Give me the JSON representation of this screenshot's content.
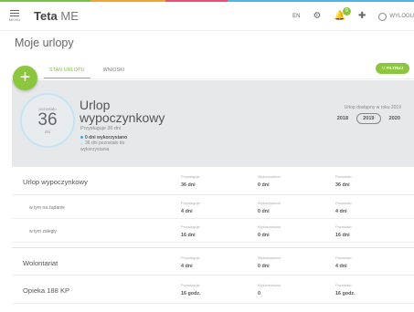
{
  "app": {
    "menu_label": "MENU",
    "brand_bold": "Teta",
    "brand_light": "ME",
    "lang": "EN",
    "notif_count": "9",
    "logout_label": "WYLOGU",
    "icons": [
      "menu-icon",
      "gear-icon",
      "bell-icon",
      "plugin-icon",
      "power-icon"
    ]
  },
  "page": {
    "title": "Moje urlopy",
    "add_label": "+",
    "tabs": [
      {
        "label": "STAN URLOPU",
        "active": true
      },
      {
        "label": "WNIOSKI",
        "active": false
      }
    ],
    "filter_label": "FILTRUJ"
  },
  "summary": {
    "circle_label": "pozostało",
    "circle_value": "36",
    "circle_unit": "dni",
    "title_line1": "Urlop",
    "title_line2": "wypoczynkowy",
    "subtitle": "Przysługuje 36 dni",
    "legend_used": "0 dni wykorzystano",
    "legend_remaining_1": "36 dni pozostało do",
    "legend_remaining_2": "wykorzystania",
    "year_caption": "Urlop dostępny w roku 2019",
    "years": [
      {
        "label": "2018",
        "active": false
      },
      {
        "label": "2019",
        "active": true
      },
      {
        "label": "2020",
        "active": false
      }
    ]
  },
  "columns": {
    "granted": "Przysługuje",
    "used": "Wykorzystano",
    "left": "Pozostało"
  },
  "rows": [
    {
      "name": "Urlop wypoczynkowy",
      "granted": "36 dni",
      "used": "0 dni",
      "left": "36 dni"
    },
    {
      "name": "w tym na żądanie",
      "granted": "4 dni",
      "used": "0 dni",
      "left": "4 dni"
    },
    {
      "name": "w tym zaległy",
      "granted": "16 dni",
      "used": "0 dni",
      "left": "16 dni"
    },
    {
      "name": "Wolontariat",
      "granted": "4 dni",
      "used": "0 dni",
      "left": "4 dni"
    },
    {
      "name": "Opieka 188 KP",
      "granted": "16 godz.",
      "used": "0",
      "left": "16 godz."
    }
  ],
  "colors": {
    "accent_green": "#8cc63f",
    "accent_blue": "#3aaae1",
    "panel_bg": "#e6e8ea"
  }
}
